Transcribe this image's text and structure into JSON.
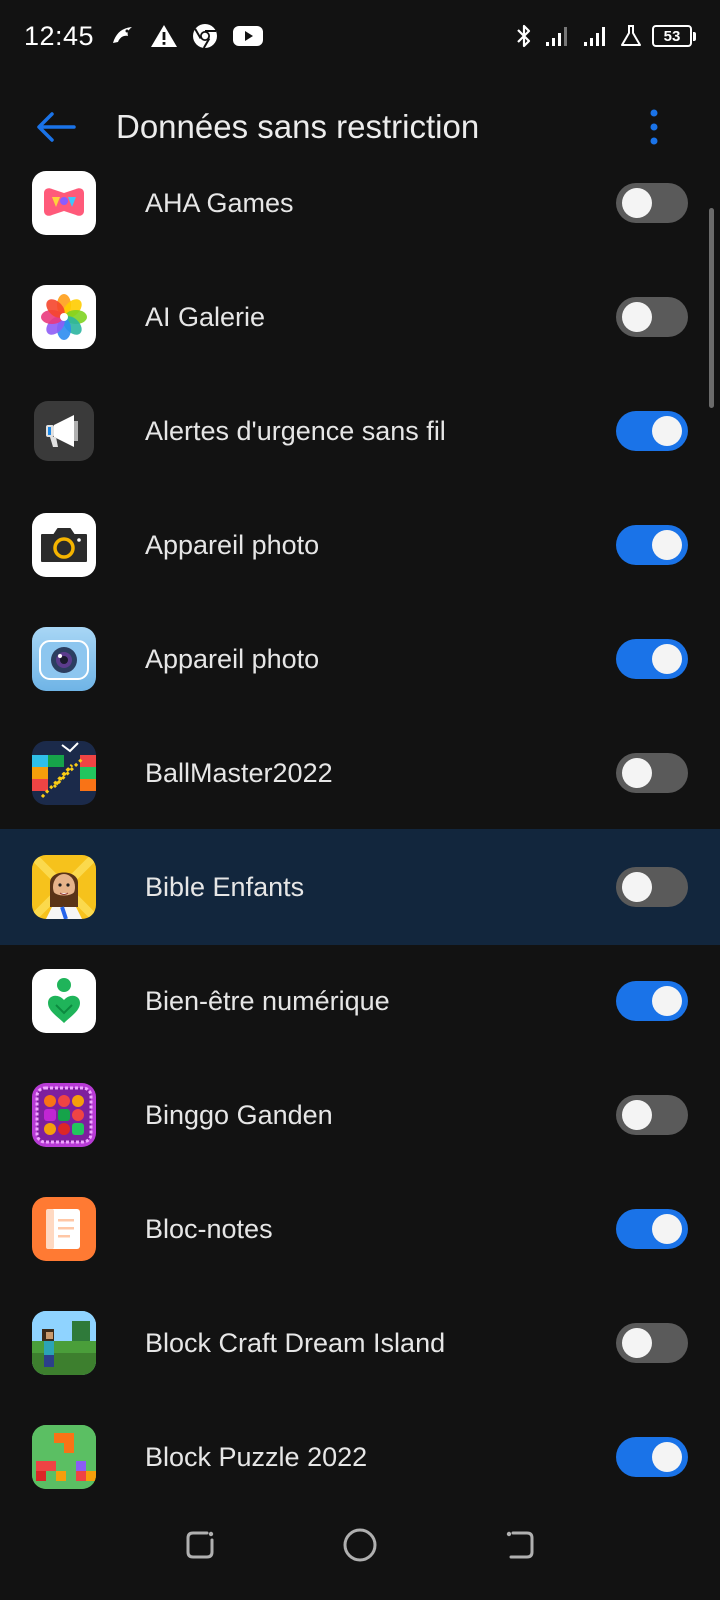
{
  "status_bar": {
    "time": "12:45",
    "icons_left": [
      "bird-icon",
      "warning-icon",
      "chrome-icon",
      "youtube-icon"
    ],
    "icons_right": [
      "bluetooth-icon",
      "signal-icon",
      "signal-icon",
      "flask-icon"
    ],
    "battery": "53"
  },
  "header": {
    "title": "Données sans restriction",
    "back_icon": "arrow-left-icon",
    "menu_icon": "more-vertical-icon"
  },
  "colors": {
    "accent": "#1a73e8",
    "background": "#121212",
    "toggle_off": "#5a5a5a",
    "highlight_row": "#12263d"
  },
  "apps": [
    {
      "label": "AHA Games",
      "icon": "aha-games-icon",
      "enabled": false,
      "highlighted": false
    },
    {
      "label": "AI Galerie",
      "icon": "gallery-icon",
      "enabled": false,
      "highlighted": false
    },
    {
      "label": "Alertes d'urgence sans fil",
      "icon": "megaphone-icon",
      "enabled": true,
      "highlighted": false
    },
    {
      "label": "Appareil photo",
      "icon": "camera-icon",
      "enabled": true,
      "highlighted": false
    },
    {
      "label": "Appareil photo",
      "icon": "camera-lens-icon",
      "enabled": true,
      "highlighted": false
    },
    {
      "label": "BallMaster2022",
      "icon": "ballmaster-icon",
      "enabled": false,
      "highlighted": false
    },
    {
      "label": "Bible Enfants",
      "icon": "bible-kids-icon",
      "enabled": false,
      "highlighted": true
    },
    {
      "label": "Bien-être numérique",
      "icon": "digital-wellbeing-icon",
      "enabled": true,
      "highlighted": false
    },
    {
      "label": "Binggo Ganden",
      "icon": "candy-game-icon",
      "enabled": false,
      "highlighted": false
    },
    {
      "label": "Bloc-notes",
      "icon": "notepad-icon",
      "enabled": true,
      "highlighted": false
    },
    {
      "label": "Block Craft Dream Island",
      "icon": "block-craft-icon",
      "enabled": false,
      "highlighted": false
    },
    {
      "label": "Block Puzzle 2022",
      "icon": "block-puzzle-icon",
      "enabled": true,
      "highlighted": false
    }
  ],
  "nav_bar": {
    "recents": "recents-icon",
    "home": "home-icon",
    "back": "back-icon"
  }
}
